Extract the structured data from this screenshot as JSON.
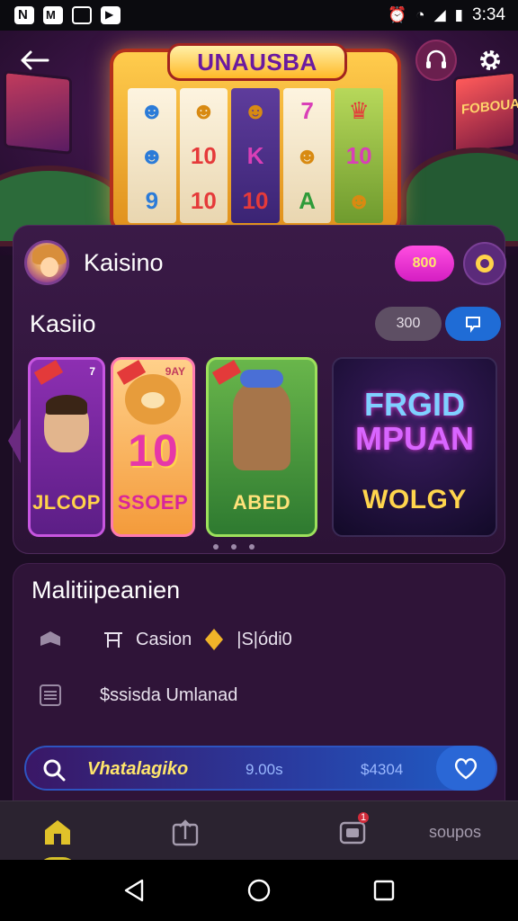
{
  "status_bar": {
    "time": "3:34"
  },
  "hero": {
    "slot_title": "UNAUSBA",
    "side_sign": "FOBOUA",
    "reels": [
      [
        "☻",
        "☻",
        "9"
      ],
      [
        "☻",
        "10",
        "10"
      ],
      [
        "☻",
        "K",
        "10"
      ],
      [
        "7",
        "☻",
        "A"
      ],
      [
        "♛",
        "10",
        "☻"
      ]
    ]
  },
  "profile": {
    "name": "Kaisino",
    "coins": "800"
  },
  "section": {
    "title": "Kasiio",
    "count": "300"
  },
  "cards": [
    {
      "label": "JLCOP",
      "corner": "7"
    },
    {
      "label": "SSOEP",
      "corner": "9AY"
    },
    {
      "label": "ABED",
      "corner": ""
    },
    {
      "label": "WOLGY",
      "line1": "FRGID",
      "line2": "MPUAN"
    }
  ],
  "panel2": {
    "title": "Malitiipeanien",
    "row1": {
      "label": "Casion",
      "value": "|S|ódi0"
    },
    "row2": {
      "label": "$ssisda Umlanad"
    }
  },
  "search_bar": {
    "text": "Vhatalagiko",
    "value1": "9.00s",
    "value2": "$4304"
  },
  "bottom_nav": {
    "more_label": "soupos",
    "badge": "1"
  },
  "colors": {
    "accent_pink": "#d41ec2",
    "accent_blue": "#1f6cd6",
    "accent_gold": "#ffd34a",
    "panel_bg": "#3a1a47"
  }
}
